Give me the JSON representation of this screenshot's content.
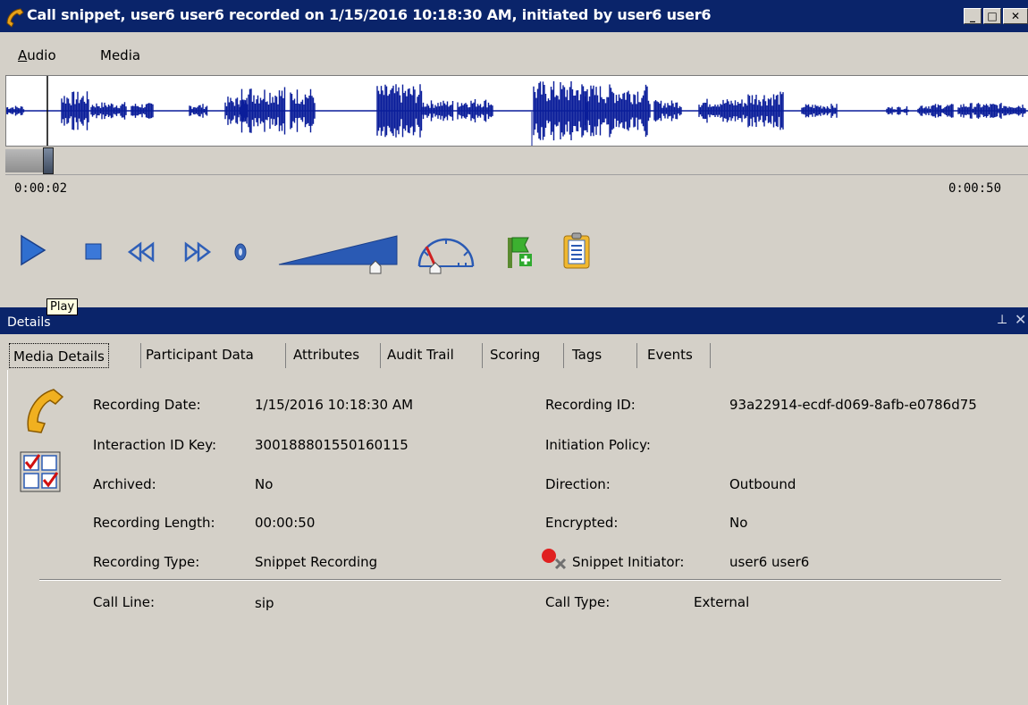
{
  "window": {
    "title": "Call snippet, user6 user6 recorded on 1/15/2016 10:18:30 AM, initiated by user6 user6",
    "icon": "phone-icon",
    "controls": [
      "minimize-icon",
      "maximize-icon",
      "close-icon"
    ]
  },
  "menu": {
    "items": [
      {
        "label": "Audio",
        "accel": "A",
        "rest": "udio"
      },
      {
        "label": "Media"
      }
    ]
  },
  "player": {
    "time_start": "0:00:02",
    "time_end": "0:00:50",
    "playhead_fraction": 0.04,
    "volume_fraction": 0.83,
    "speed_fraction": 0.38,
    "tooltip": "Play",
    "colors": {
      "accent": "#2a5ab4",
      "waveform": "#0a1d9a"
    }
  },
  "details_panel": {
    "title": "Details",
    "tabs": [
      "Media Details",
      "Participant Data",
      "Attributes",
      "Audit Trail",
      "Scoring",
      "Tags",
      "Events"
    ],
    "active_tab": "Media Details",
    "left_fields": [
      {
        "label": "Recording Date:",
        "value": "1/15/2016 10:18:30 AM"
      },
      {
        "label": "Interaction ID Key:",
        "value": "300188801550160115"
      },
      {
        "label": "Archived:",
        "value": "No"
      },
      {
        "label": "Recording Length:",
        "value": "00:00:50"
      },
      {
        "label": "Recording Type:",
        "value": "Snippet Recording"
      }
    ],
    "right_fields": [
      {
        "label": "Recording ID:",
        "value": "93a22914-ecdf-d069-8afb-e0786d75"
      },
      {
        "label": "Initiation Policy:",
        "value": ""
      },
      {
        "label": "Direction:",
        "value": "Outbound"
      },
      {
        "label": "Encrypted:",
        "value": "No"
      },
      {
        "label": "Snippet Initiator:",
        "value": "user6 user6"
      }
    ],
    "bottom_fields": [
      {
        "label": "Call Line:",
        "value": "sip"
      },
      {
        "label": "Call Type:",
        "value": "External"
      }
    ]
  }
}
